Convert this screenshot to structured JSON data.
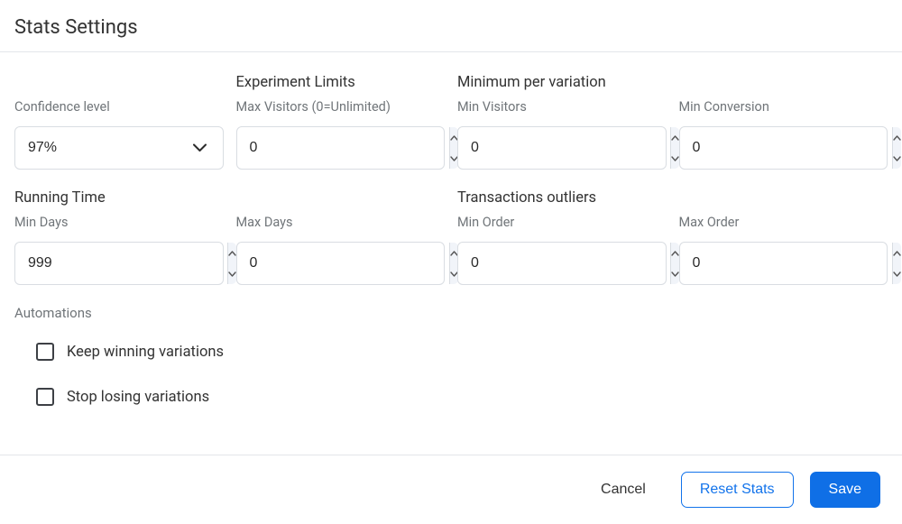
{
  "title": "Stats Settings",
  "row1": {
    "confidence": {
      "section": "",
      "label": "Confidence level",
      "value": "97%"
    },
    "experiment_limits": {
      "section": "Experiment Limits",
      "label": "Max Visitors (0=Unlimited)",
      "value": "0"
    },
    "min_per_variation": {
      "section": "Minimum per variation",
      "label": "Min Visitors",
      "value": "0"
    },
    "min_conversion": {
      "section": "",
      "label": "Min Conversion",
      "value": "0"
    }
  },
  "row2": {
    "running_time": {
      "section": "Running Time",
      "label": "Min Days",
      "value": "999"
    },
    "max_days": {
      "section": "",
      "label": "Max Days",
      "value": "0"
    },
    "transactions_outliers": {
      "section": "Transactions outliers",
      "label": "Min Order",
      "value": "0"
    },
    "max_order": {
      "section": "",
      "label": "Max Order",
      "value": "0"
    }
  },
  "automations": {
    "title": "Automations",
    "keep_winning": "Keep winning variations",
    "stop_losing": "Stop losing variations"
  },
  "footer": {
    "cancel": "Cancel",
    "reset": "Reset Stats",
    "save": "Save"
  }
}
